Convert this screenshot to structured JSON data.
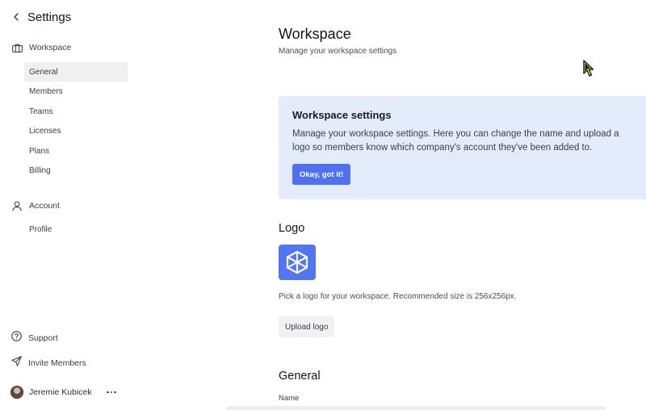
{
  "sidebar": {
    "title": "Settings",
    "back_icon": "chevron-left-icon",
    "workspace_section": {
      "label": "Workspace",
      "icon": "briefcase-icon"
    },
    "workspace_items": [
      {
        "label": "General",
        "active": true
      },
      {
        "label": "Members",
        "active": false
      },
      {
        "label": "Teams",
        "active": false
      },
      {
        "label": "Licenses",
        "active": false
      },
      {
        "label": "Plans",
        "active": false
      },
      {
        "label": "Billing",
        "active": false
      }
    ],
    "account_section": {
      "label": "Account",
      "icon": "user-icon"
    },
    "account_items": [
      {
        "label": "Profile",
        "active": false
      }
    ],
    "support": {
      "label": "Support",
      "icon": "help-circle-icon"
    },
    "invite": {
      "label": "Invite Members",
      "icon": "send-icon"
    },
    "user": {
      "name": "Jeremie Kubicek",
      "more_icon": "more-horizontal-icon"
    }
  },
  "main": {
    "title": "Workspace",
    "subtitle": "Manage your workspace settings",
    "banner": {
      "title": "Workspace settings",
      "text": "Manage your workspace settings. Here you can change the name and upload a logo so members know which company's account they've been added to.",
      "button": "Okay, got it!"
    },
    "logo_section": {
      "title": "Logo",
      "logo_icon": "cube-logo-icon",
      "help": "Pick a logo for your workspace. Recommended size is 256x256px.",
      "upload_button": "Upload logo"
    },
    "general_section": {
      "title": "General",
      "name_label": "Name"
    }
  },
  "colors": {
    "accent": "#5070f2",
    "banner_bg": "#e4ebfb",
    "active_nav_bg": "#f0f0f1",
    "logo_bg": "#5276f2",
    "cursor": "#f5e93a"
  }
}
